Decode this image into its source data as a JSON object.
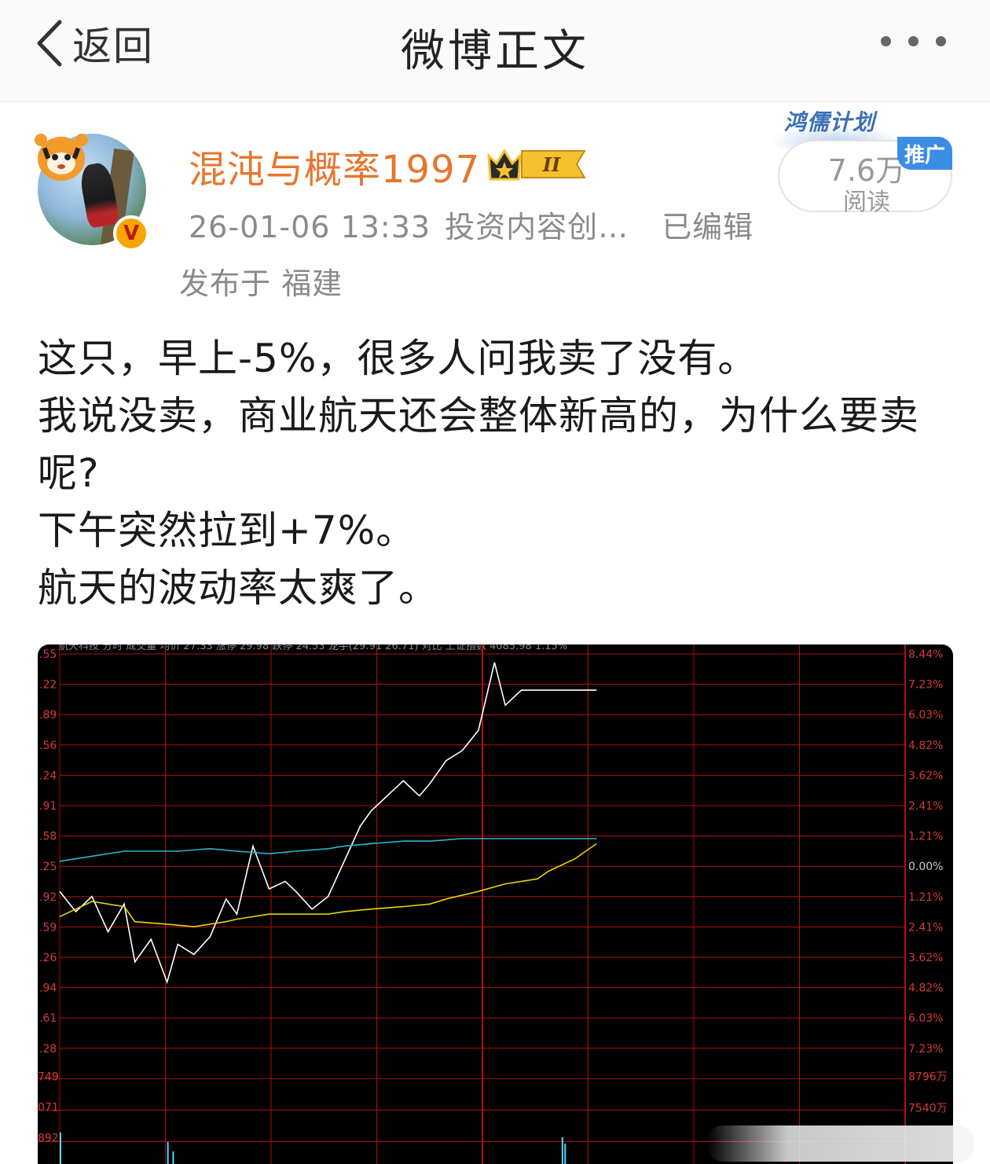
{
  "header": {
    "back_label": "返回",
    "title": "微博正文",
    "more_icon": "more-dots-icon"
  },
  "post": {
    "author": "混沌与概率1997",
    "member_level": "II",
    "verified_mark": "V",
    "timestamp": "26-01-06 13:33",
    "source": "投资内容创…",
    "edited": "已编辑",
    "location": "发布于 福建",
    "promo_label": "鸿儒计划",
    "read_count": "7.6万",
    "read_label": "阅读",
    "ad_label": "推广",
    "text_lines": [
      "这只，早上-5%，很多人问我卖了没有。",
      "我说没卖，商业航天还会整体新高的，为什么要卖呢?",
      "下午突然拉到+7%。",
      "航天的波动率太爽了。"
    ]
  },
  "chart_data": {
    "type": "line",
    "title": "航天科技 分时 成交量 均价 27.33 涨停 29.98 跌停 24.53 龙手(29.91 26.71) 对比 上证指数 4085.98 1.15%",
    "left_ticks": [
      ".55",
      ".22",
      ".89",
      ".56",
      ".24",
      ".91",
      ".58",
      ".25",
      ".92",
      ".59",
      ".26",
      ".94",
      ".61",
      ".28"
    ],
    "right_ticks": [
      "8.44%",
      "7.23%",
      "6.03%",
      "4.82%",
      "3.62%",
      "2.41%",
      "1.21%",
      "0.00%",
      "1.21%",
      "2.41%",
      "3.62%",
      "4.82%",
      "6.03%",
      "7.23%"
    ],
    "volume_left_ticks": [
      "749",
      "071",
      "892"
    ],
    "volume_right_ticks": [
      "8796万",
      "7540万"
    ],
    "x_session_fraction": [
      0,
      0.03,
      0.06,
      0.09,
      0.12,
      0.14,
      0.17,
      0.2,
      0.22,
      0.25,
      0.28,
      0.31,
      0.33,
      0.36,
      0.39,
      0.42,
      0.44,
      0.47,
      0.5,
      0.53,
      0.56,
      0.58,
      0.61,
      0.64,
      0.67,
      0.69,
      0.72,
      0.75,
      0.78,
      0.81,
      0.83,
      0.86,
      0.89,
      0.91,
      0.94,
      0.96,
      0.98,
      1.0
    ],
    "series": [
      {
        "name": "price",
        "color": "#ffffff",
        "values": [
          -1.0,
          -1.8,
          -1.2,
          -2.6,
          -1.5,
          -3.8,
          -2.9,
          -4.6,
          -3.1,
          -3.5,
          -2.8,
          -1.3,
          -1.9,
          0.8,
          -0.9,
          -0.6,
          -1.0,
          -1.7,
          -1.2,
          0.2,
          1.6,
          2.2,
          2.8,
          3.4,
          2.8,
          3.3,
          4.2,
          4.6,
          5.4,
          8.1,
          6.4,
          7.0,
          7.0,
          7.0,
          7.0,
          7.0,
          7.0,
          7.0
        ]
      },
      {
        "name": "avg",
        "color": "#e8d400",
        "values": [
          -2.0,
          -1.4,
          -1.6,
          -2.2,
          -2.3,
          -2.4,
          -2.2,
          -2.1,
          -1.9,
          -1.9,
          -1.9,
          -1.8,
          -1.7,
          -1.6,
          -1.5,
          -1.3,
          -1.0,
          -0.7,
          -0.5,
          -0.2,
          0.3,
          0.9
        ]
      },
      {
        "name": "index",
        "color": "#2bb7c8",
        "values": [
          0.2,
          0.4,
          0.6,
          0.6,
          0.6,
          0.7,
          0.6,
          0.5,
          0.6,
          0.7,
          0.8,
          0.9,
          1.0,
          1.0,
          1.1,
          1.1,
          1.1,
          1.1,
          1.1,
          1.1
        ]
      }
    ],
    "ylim_pct": [
      -7.23,
      8.44
    ],
    "grid": true,
    "colors": {
      "background": "#000000",
      "grid": "#b01010",
      "axis_text": "#d63a3a"
    }
  }
}
